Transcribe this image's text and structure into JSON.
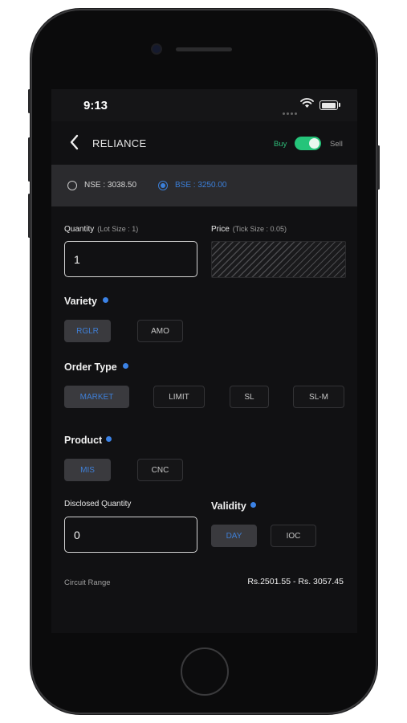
{
  "status": {
    "time": "9:13"
  },
  "header": {
    "title": "RELIANCE",
    "buy_label": "Buy",
    "sell_label": "Sell",
    "side_is_sell": true
  },
  "exchange": {
    "nse_label": "NSE : 3038.50",
    "bse_label": "BSE : 3250.00",
    "selected": "BSE"
  },
  "quantity": {
    "label": "Quantity",
    "hint": "(Lot Size : 1)",
    "value": "1"
  },
  "price": {
    "label": "Price",
    "hint": "(Tick Size : 0.05)"
  },
  "variety": {
    "label": "Variety",
    "options": [
      "RGLR",
      "AMO"
    ],
    "selected": "RGLR"
  },
  "order_type": {
    "label": "Order Type",
    "options": [
      "MARKET",
      "LIMIT",
      "SL",
      "SL-M"
    ],
    "selected": "MARKET"
  },
  "product": {
    "label": "Product",
    "options": [
      "MIS",
      "CNC"
    ],
    "selected": "MIS"
  },
  "disclosed": {
    "label": "Disclosed Quantity",
    "value": "0"
  },
  "validity": {
    "label": "Validity",
    "options": [
      "DAY",
      "IOC"
    ],
    "selected": "DAY"
  },
  "circuit": {
    "label": "Circuit Range",
    "value": "Rs.2501.55 - Rs. 3057.45"
  },
  "colors": {
    "accent_blue": "#3b82e6",
    "buy_green": "#25c47a",
    "panel": "#2b2b2e"
  }
}
